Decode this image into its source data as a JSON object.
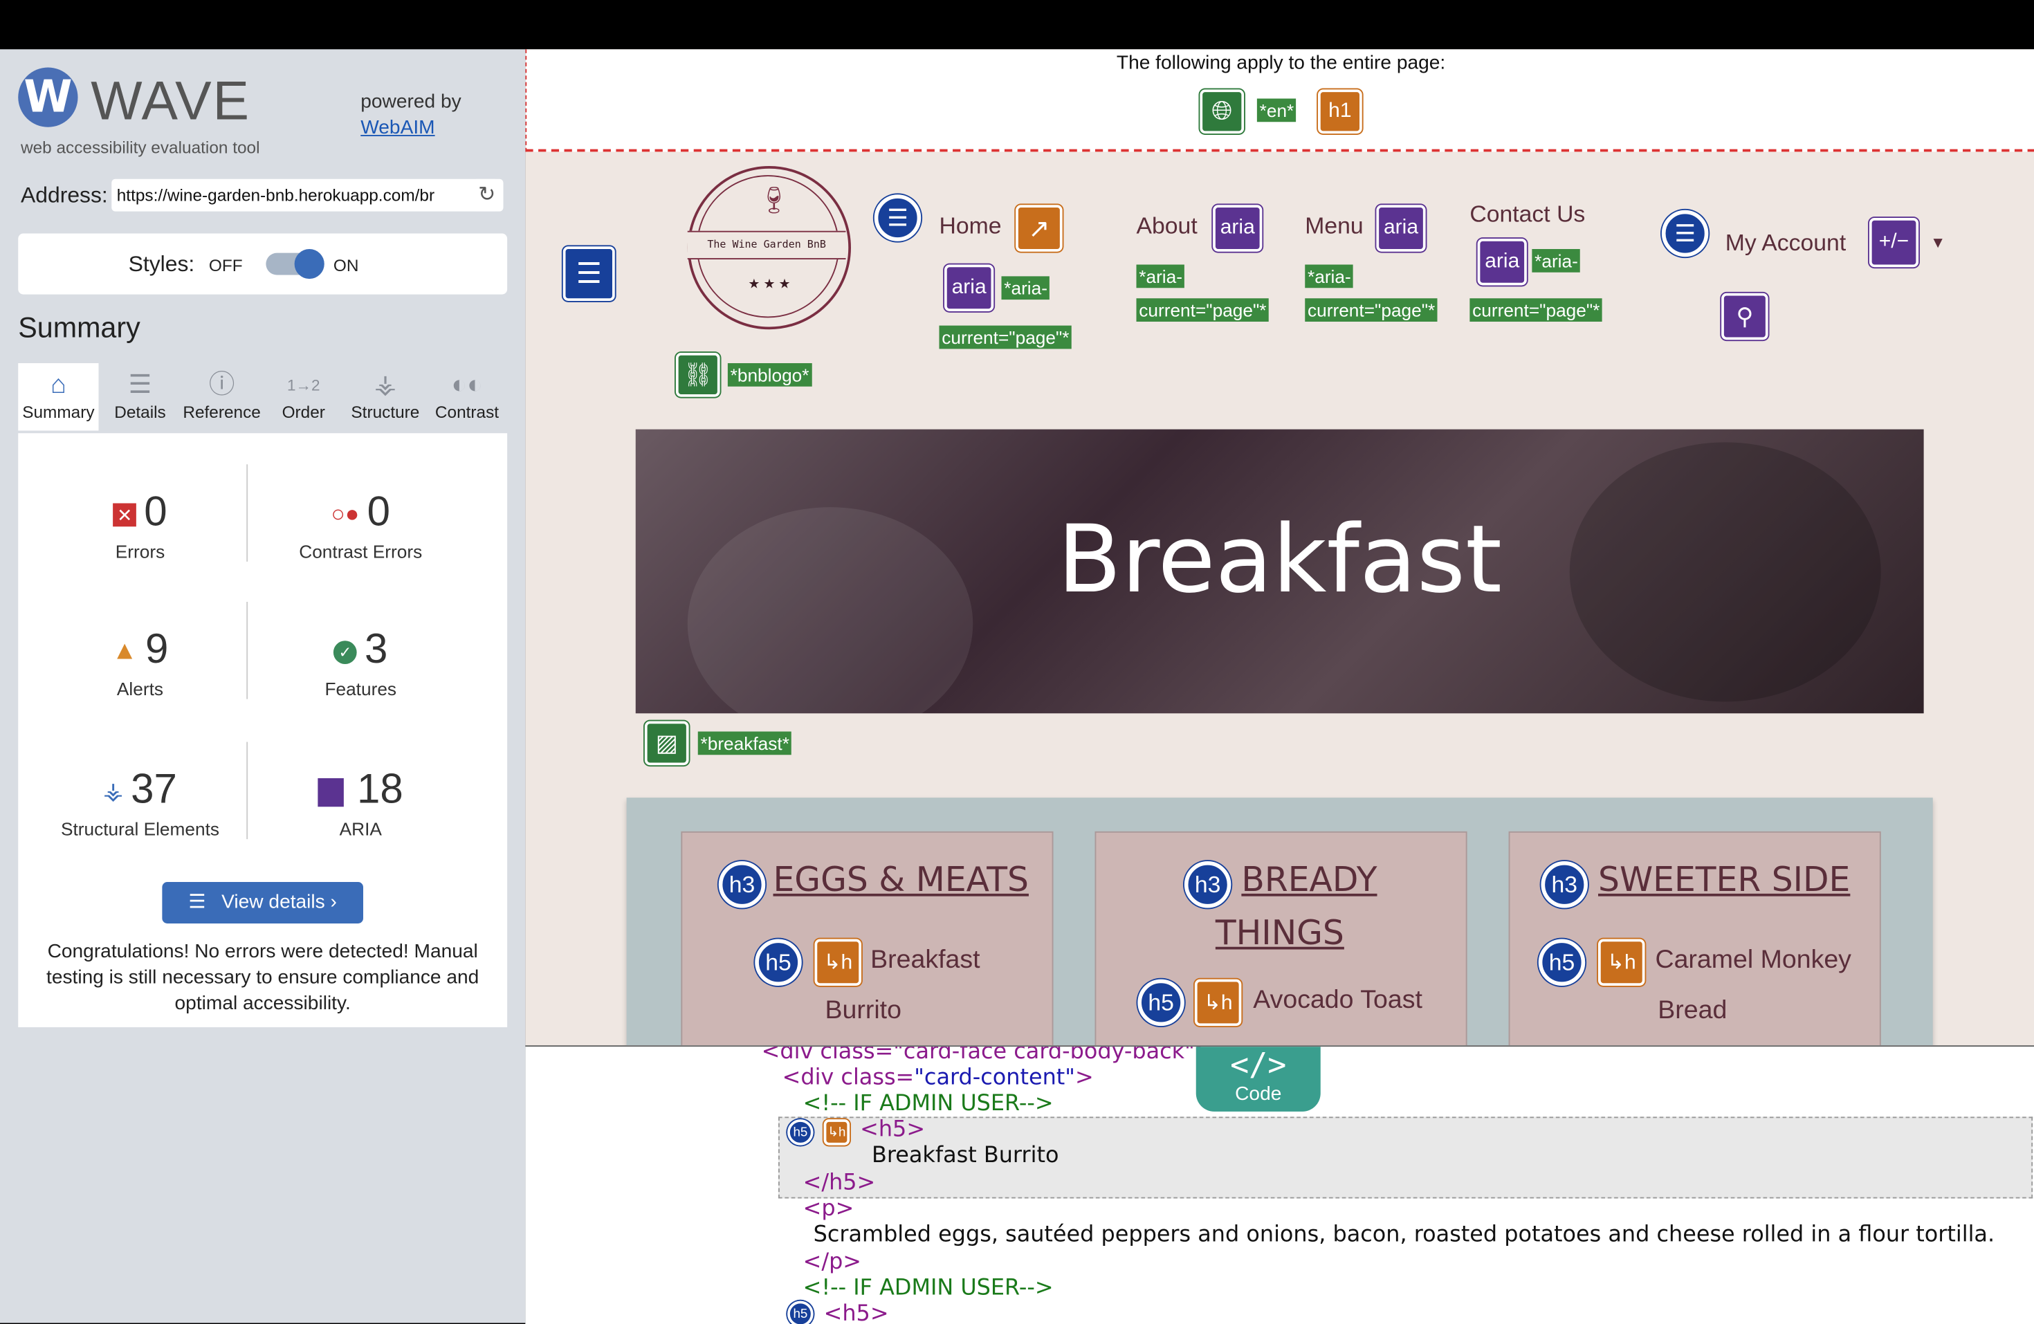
{
  "wave": {
    "title": "WAVE",
    "subtitle": "web accessibility evaluation tool",
    "powered_by": "powered by",
    "webaim": "WebAIM",
    "address_label": "Address:",
    "address_value": "https://wine-garden-bnb.herokuapp.com/br",
    "styles_label": "Styles:",
    "styles_off": "OFF",
    "styles_on": "ON",
    "summary_heading": "Summary",
    "tabs": [
      {
        "label": "Summary",
        "icon": "home-icon"
      },
      {
        "label": "Details",
        "icon": "list-icon"
      },
      {
        "label": "Reference",
        "icon": "info-icon"
      },
      {
        "label": "Order",
        "icon": "order-icon"
      },
      {
        "label": "Structure",
        "icon": "structure-icon"
      },
      {
        "label": "Contrast",
        "icon": "contrast-icon"
      }
    ],
    "stats": {
      "errors": {
        "count": "0",
        "label": "Errors"
      },
      "contrast_errors": {
        "count": "0",
        "label": "Contrast Errors"
      },
      "alerts": {
        "count": "9",
        "label": "Alerts"
      },
      "features": {
        "count": "3",
        "label": "Features"
      },
      "structural": {
        "count": "37",
        "label": "Structural Elements"
      },
      "aria": {
        "count": "18",
        "label": "ARIA"
      }
    },
    "view_details": "View details ›",
    "congrats": "Congratulations! No errors were detected! Manual testing is still necessary to ensure compliance and optimal accessibility."
  },
  "page": {
    "apply_text": "The following apply to the entire page:",
    "lang_label": "*en*",
    "h1": "h1",
    "logo_text": "The Wine Garden BnB",
    "logo_stars": "★ ★ ★",
    "bnblogo_label": "*bnblogo*",
    "nav": {
      "home": "Home",
      "about": "About",
      "menu": "Menu",
      "contact": "Contact Us",
      "account": "My Account",
      "aria_current_1": "*aria-",
      "aria_current_2": "current=\"page\"*"
    },
    "aria": "aria",
    "plusminus": "+/−",
    "hero_title": "Breakfast",
    "breakfast_label": "*breakfast*",
    "cards": [
      {
        "heading_line1": "EGGS & MEATS",
        "heading_line2": "",
        "item_line1": "Breakfast",
        "item_line2": "Burrito"
      },
      {
        "heading_line1": "BREADY",
        "heading_line2": "THINGS",
        "item_line1": "Avocado Toast",
        "item_line2": ""
      },
      {
        "heading_line1": "SWEETER SIDE",
        "heading_line2": "",
        "item_line1": "Caramel Monkey",
        "item_line2": "Bread"
      }
    ],
    "h3": "h3",
    "h5": "h5"
  },
  "code": {
    "tab_label": "Code",
    "tab_icon": "</>",
    "line0": "<div class=\"card-face card-body-back\">",
    "line1_tag": "<div class=",
    "line1_val": "\"card-content\"",
    "line1_end": ">",
    "comment": "<!-- IF ADMIN USER-->",
    "h5_open": "<h5>",
    "h5_text": "Breakfast Burrito",
    "h5_close": "</h5>",
    "p_open": "<p>",
    "p_text": "Scrambled eggs, sautéed peppers and onions, bacon, roasted potatoes and cheese rolled in a flour tortilla.",
    "p_close": "</p>"
  },
  "colors": {
    "wave_blue": "#3a6cb8",
    "structure_blue": "#17409a",
    "feature_green": "#2f7a3c",
    "alert_orange": "#c86e1c",
    "aria_purple": "#5b3391",
    "brand_maroon": "#5a2e3a"
  }
}
